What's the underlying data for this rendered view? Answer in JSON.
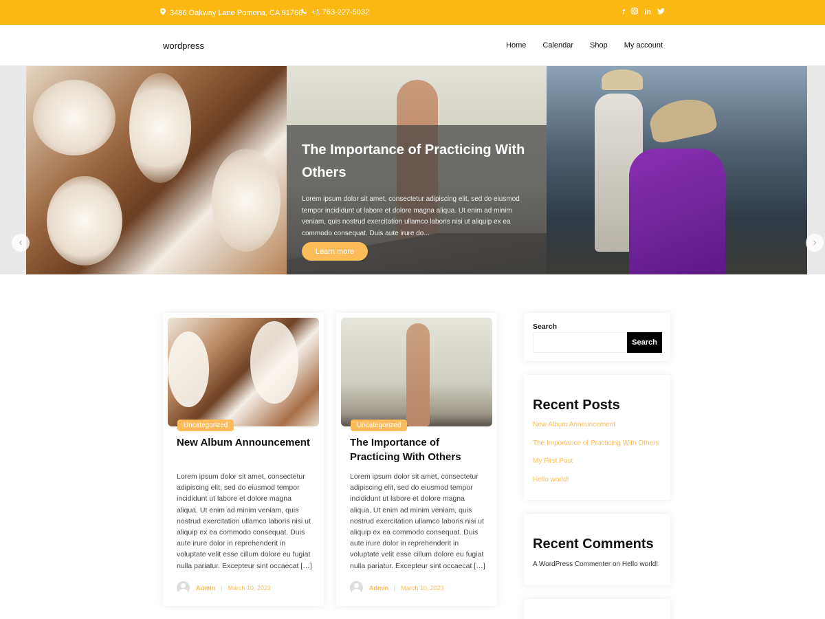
{
  "topbar": {
    "address": "3486 Oakway Lane Pomona, CA 91766",
    "phone": "+1 763-227-5032",
    "social": [
      "facebook-icon",
      "instagram-icon",
      "linkedin-icon",
      "twitter-icon"
    ]
  },
  "header": {
    "logo": "wordpress",
    "nav": [
      "Home",
      "Calendar",
      "Shop",
      "My account"
    ]
  },
  "slider": {
    "title": "The Importance of Practicing With Others",
    "text": "Lorem ipsum dolor sit amet, consectetur adipiscing elit, sed do eiusmod tempor incididunt ut labore et dolore magna aliqua. Ut enim ad minim veniam, quis nostrud exercitation ullamco laboris nisi ut aliquip ex ea commodo consequat. Duis aute irure do...",
    "button": "Learn more",
    "prev": "‹",
    "next": "›"
  },
  "posts": [
    {
      "category": "Uncategorized",
      "title": "New Album Announcement",
      "excerpt": "Lorem ipsum dolor sit amet, consectetur adipiscing elit, sed do eiusmod tempor incididunt ut labore et dolore magna aliqua. Ut enim ad minim veniam, quis nostrud exercitation ullamco laboris nisi ut aliquip ex ea commodo consequat. Duis aute irure dolor in reprehenderit in voluptate velit esse cillum dolore eu fugiat nulla pariatur. Excepteur sint occaecat […]",
      "author": "Admin",
      "date": "March 10, 2023"
    },
    {
      "category": "Uncategorized",
      "title": "The Importance of Practicing With Others",
      "excerpt": "Lorem ipsum dolor sit amet, consectetur adipiscing elit, sed do eiusmod tempor incididunt ut labore et dolore magna aliqua. Ut enim ad minim veniam, quis nostrud exercitation ullamco laboris nisi ut aliquip ex ea commodo consequat. Duis aute irure dolor in reprehenderit in voluptate velit esse cillum dolore eu fugiat nulla pariatur. Excepteur sint occaecat […]",
      "author": "Admin",
      "date": "March 10, 2023"
    }
  ],
  "sidebar": {
    "search_label": "Search",
    "search_button": "Search",
    "search_value": "",
    "recent_posts_title": "Recent Posts",
    "recent_posts": [
      "New Album Announcement",
      "The Importance of Practicing With Others",
      "My First Post",
      "Hello world!"
    ],
    "recent_comments_title": "Recent Comments",
    "comment_author": "A WordPress Commenter",
    "comment_on": "on",
    "comment_post": "Hello world!"
  },
  "colors": {
    "accent": "#fdb813",
    "button": "#fdbc5a",
    "search_button": "#000000"
  }
}
